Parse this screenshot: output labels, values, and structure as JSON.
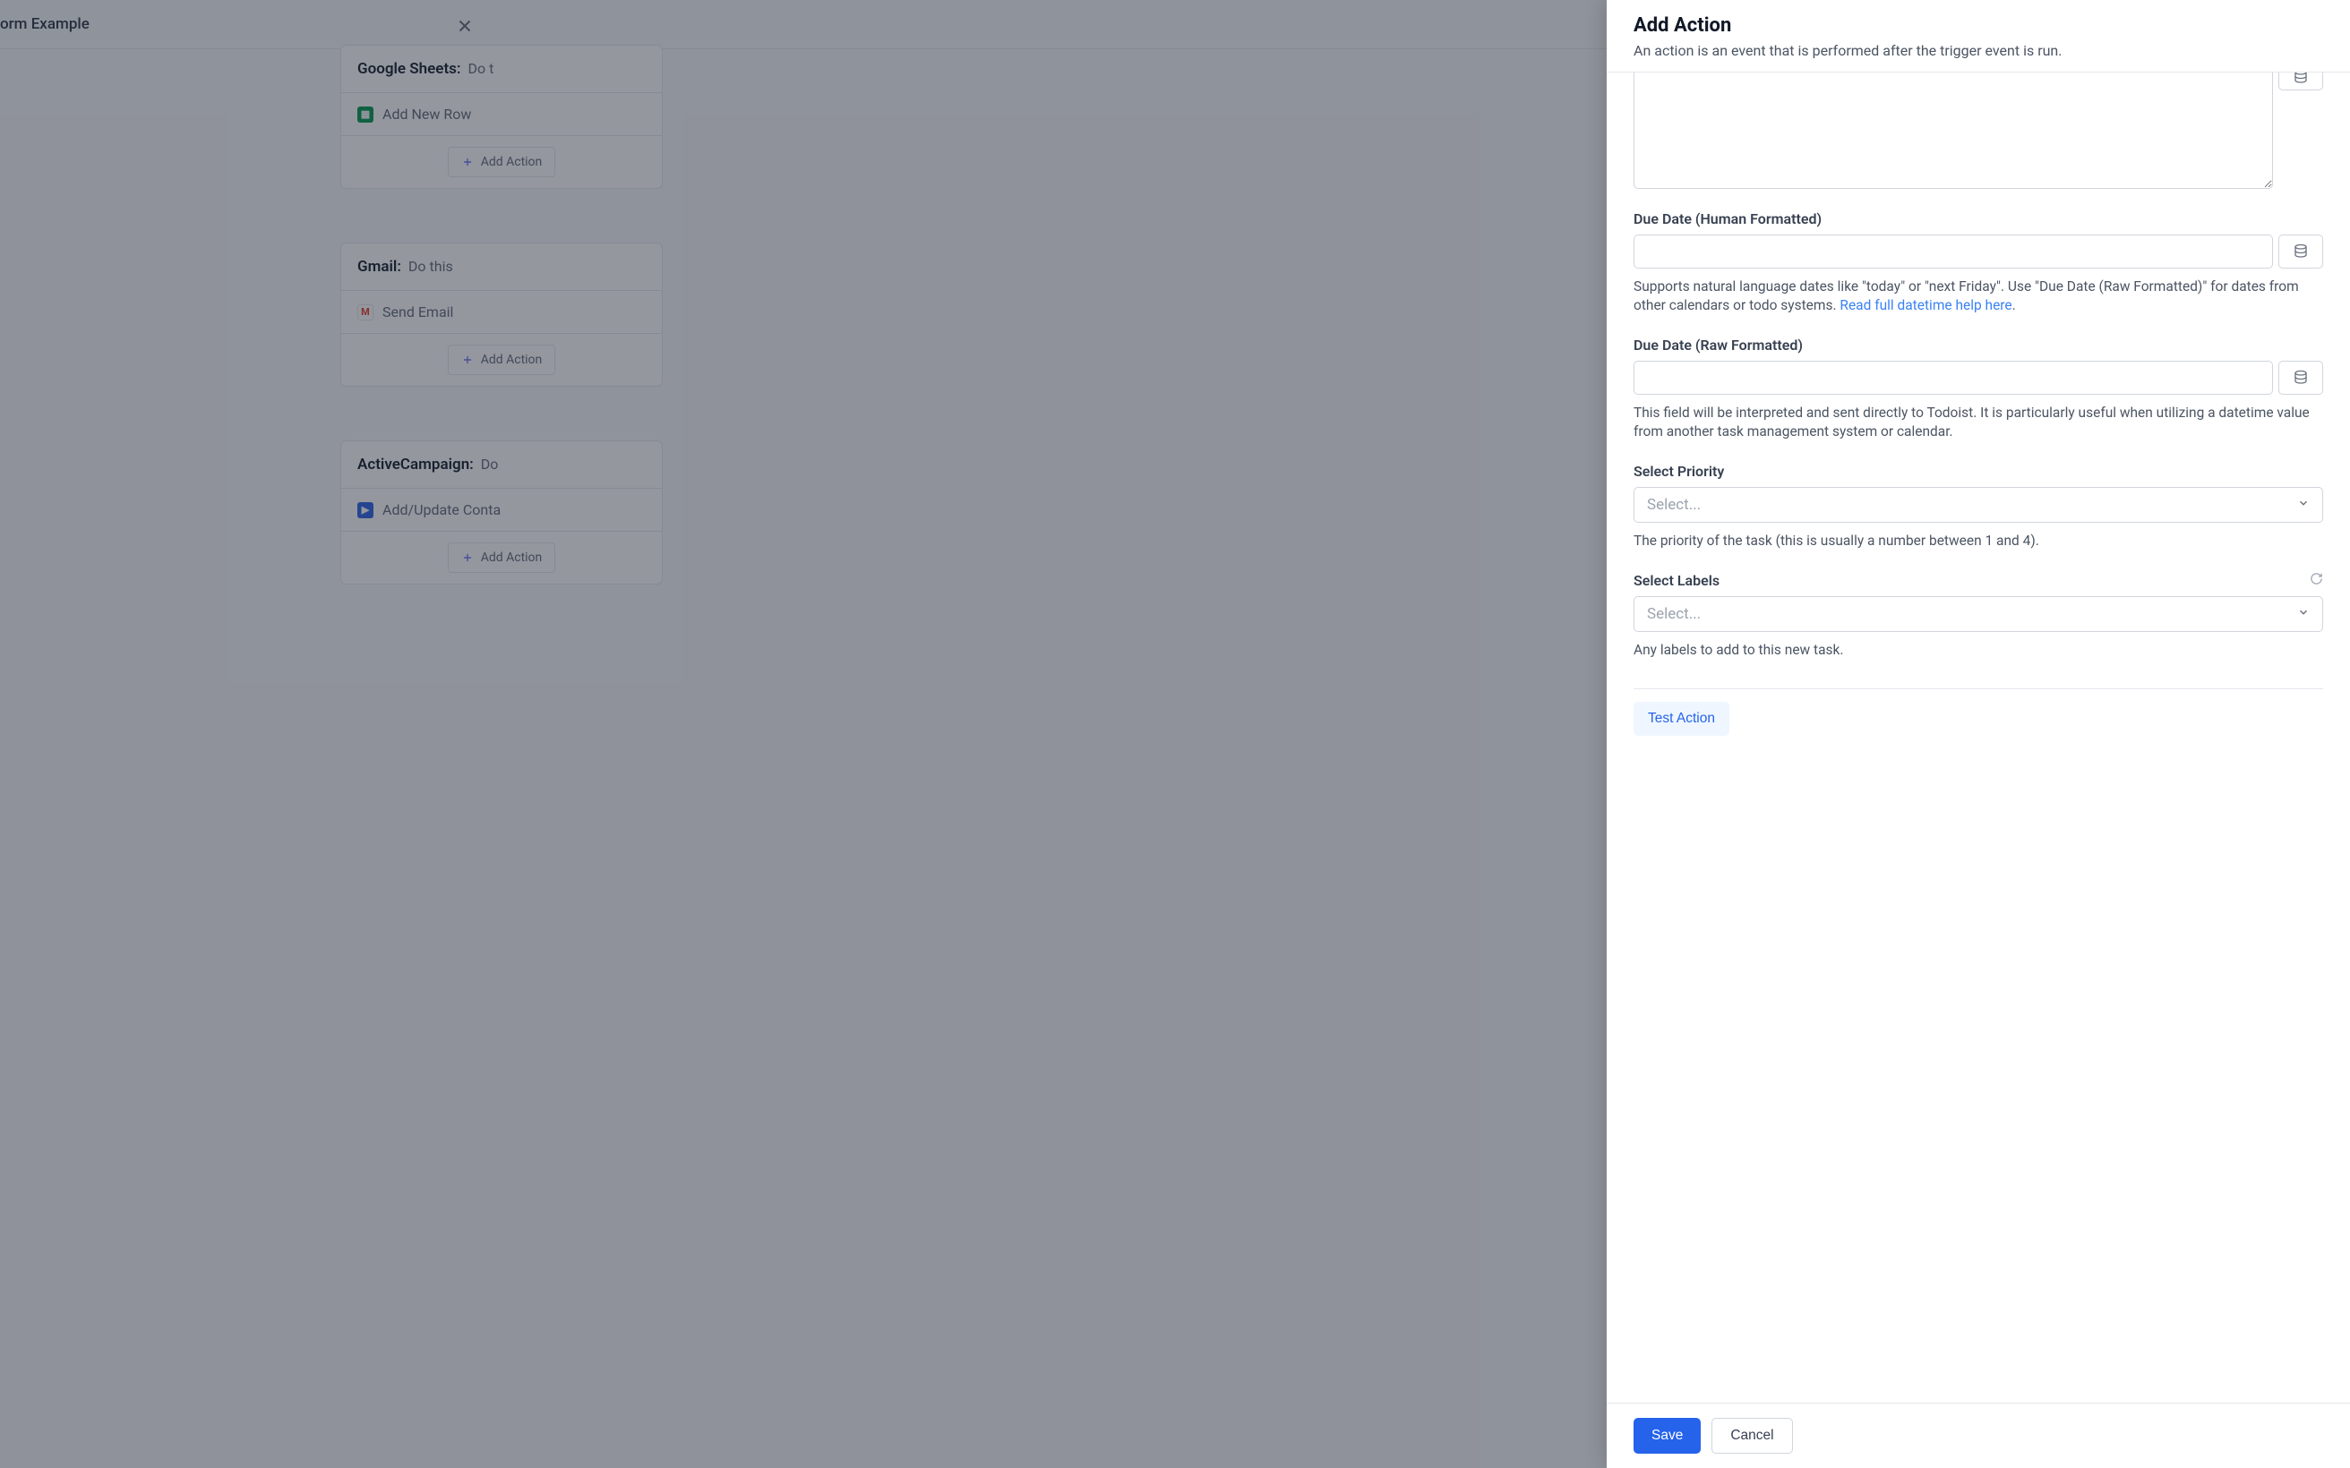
{
  "background": {
    "page_title_fragment": "orm Example",
    "cards": [
      {
        "service": "Google Sheets:",
        "subtitle": "Do t",
        "action": "Add New Row",
        "icon": "sheets",
        "add_label": "Add Action"
      },
      {
        "service": "Gmail:",
        "subtitle": "Do this",
        "action": "Send Email",
        "icon": "gmail",
        "add_label": "Add Action"
      },
      {
        "service": "ActiveCampaign:",
        "subtitle": "Do",
        "action": "Add/Update Conta",
        "icon": "ac",
        "add_label": "Add Action"
      }
    ]
  },
  "panel": {
    "title": "Add Action",
    "description": "An action is an event that is performed after the trigger event is run.",
    "fields": {
      "due_human": {
        "label": "Due Date (Human Formatted)",
        "help_prefix": "Supports natural language dates like \"today\" or \"next Friday\". Use \"Due Date (Raw Formatted)\" for dates from other calendars or todo systems. ",
        "help_link": "Read full datetime help here",
        "help_suffix": "."
      },
      "due_raw": {
        "label": "Due Date (Raw Formatted)",
        "help": "This field will be interpreted and sent directly to Todoist. It is particularly useful when utilizing a datetime value from another task management system or calendar."
      },
      "priority": {
        "label": "Select Priority",
        "placeholder": "Select...",
        "help": "The priority of the task (this is usually a number between 1 and 4)."
      },
      "labels": {
        "label": "Select Labels",
        "placeholder": "Select...",
        "help": "Any labels to add to this new task."
      }
    },
    "buttons": {
      "test": "Test Action",
      "save": "Save",
      "cancel": "Cancel"
    }
  }
}
